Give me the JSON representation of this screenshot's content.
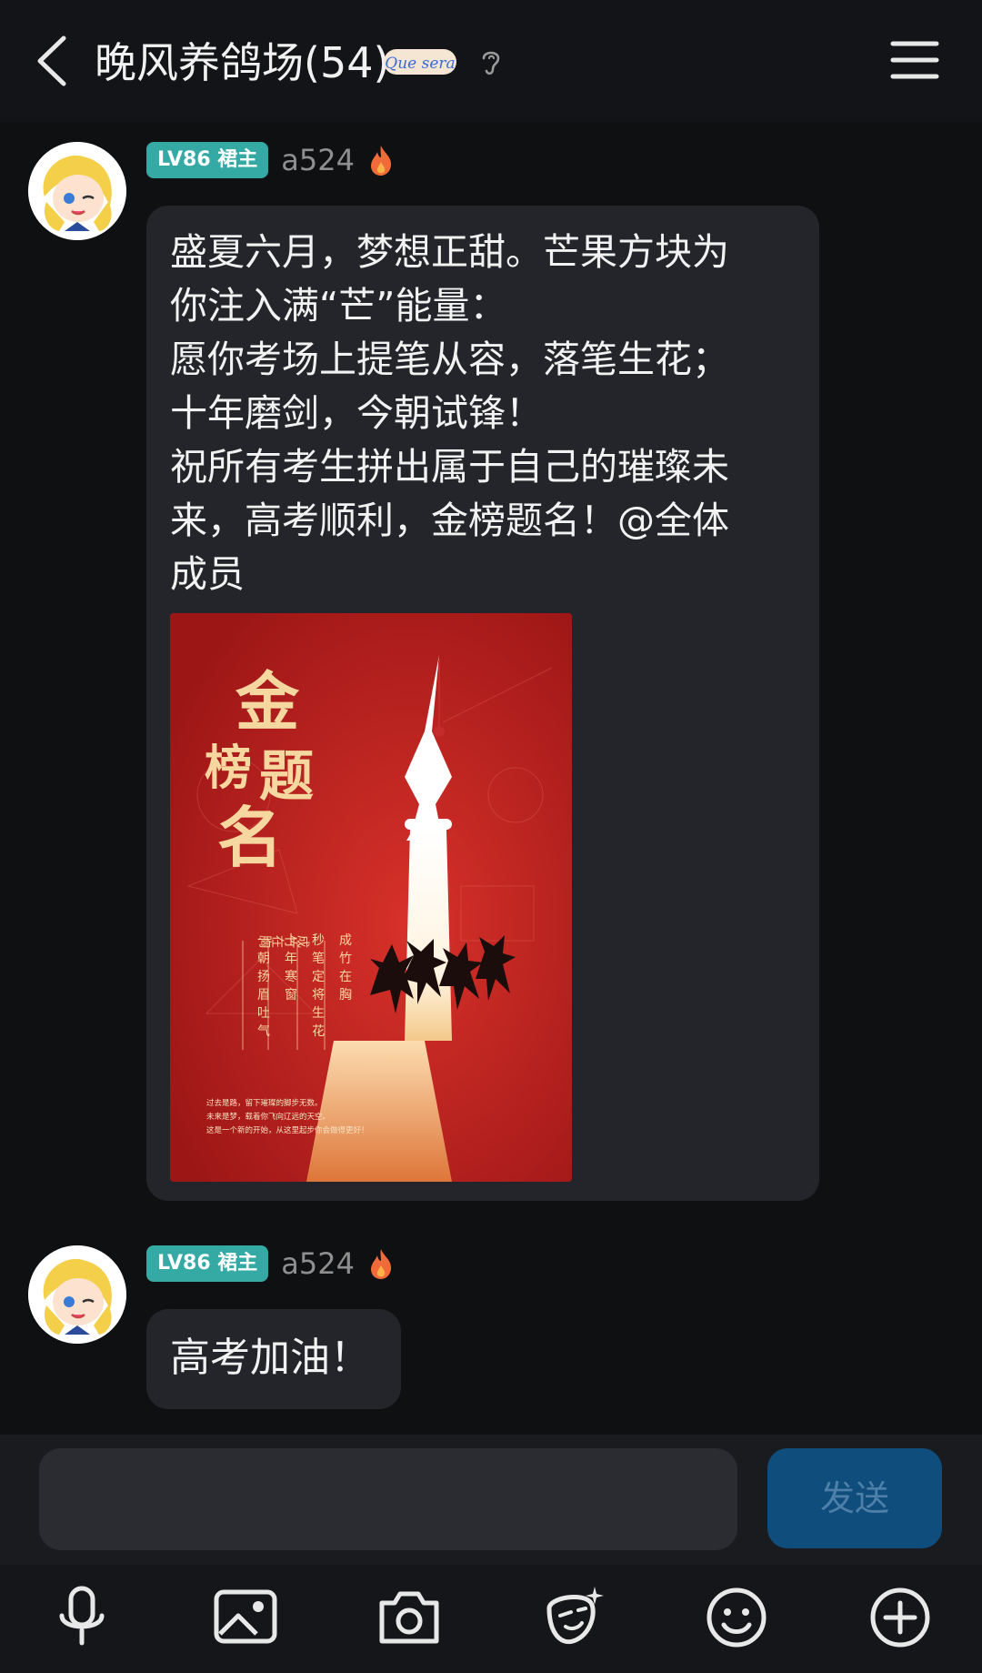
{
  "header": {
    "title": "晚风养鸽场(54)",
    "logo_text": "Que sera"
  },
  "messages": [
    {
      "level": "LV86 裙主",
      "username": "a524",
      "text": "盛夏六月，梦想正甜。芒果方块为\n你注入满“芒”能量：\n愿你考场上提笔从容，落笔生花；\n十年磨剑，今朝试锋！\n祝所有考生拼出属于自己的璀璨未\n来，高考顺利，金榜题名！@全体\n成员",
      "poster": {
        "title_chars": [
          "金",
          "榜",
          "题",
          "名"
        ],
        "columns": [
          "成竹在胸",
          "秒笔定将生花",
          "十年寒窗",
          "一朝扬眉吐气"
        ],
        "footer_lines": [
          "过去是路，留下璀璨的脚步无数。",
          "未来是梦，载着你飞向辽远的天空。",
          "这是一个新的开始，从这里起步你会做得更好！"
        ]
      }
    },
    {
      "level": "LV86 裙主",
      "username": "a524",
      "text": "高考加油！"
    }
  ],
  "input": {
    "placeholder": "",
    "send_label": "发送"
  },
  "toolbar": [
    "microphone-icon",
    "image-icon",
    "camera-icon",
    "magic-sticker-icon",
    "emoji-icon",
    "plus-icon"
  ],
  "colors": {
    "level_badge": "#35aaa5",
    "send_button": "#0f4d7d",
    "poster_red": "#b31c1c"
  }
}
